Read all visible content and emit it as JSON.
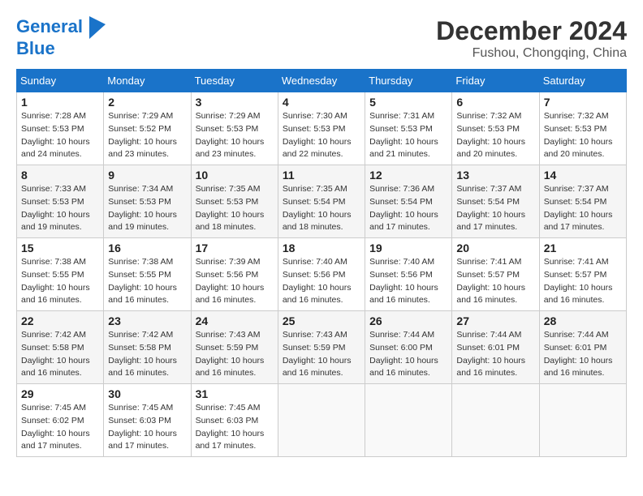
{
  "header": {
    "logo_line1": "General",
    "logo_line2": "Blue",
    "month_title": "December 2024",
    "location": "Fushou, Chongqing, China"
  },
  "days_of_week": [
    "Sunday",
    "Monday",
    "Tuesday",
    "Wednesday",
    "Thursday",
    "Friday",
    "Saturday"
  ],
  "weeks": [
    [
      {
        "day": "1",
        "sunrise": "7:28 AM",
        "sunset": "5:53 PM",
        "daylight": "10 hours and 24 minutes."
      },
      {
        "day": "2",
        "sunrise": "7:29 AM",
        "sunset": "5:52 PM",
        "daylight": "10 hours and 23 minutes."
      },
      {
        "day": "3",
        "sunrise": "7:29 AM",
        "sunset": "5:53 PM",
        "daylight": "10 hours and 23 minutes."
      },
      {
        "day": "4",
        "sunrise": "7:30 AM",
        "sunset": "5:53 PM",
        "daylight": "10 hours and 22 minutes."
      },
      {
        "day": "5",
        "sunrise": "7:31 AM",
        "sunset": "5:53 PM",
        "daylight": "10 hours and 21 minutes."
      },
      {
        "day": "6",
        "sunrise": "7:32 AM",
        "sunset": "5:53 PM",
        "daylight": "10 hours and 20 minutes."
      },
      {
        "day": "7",
        "sunrise": "7:32 AM",
        "sunset": "5:53 PM",
        "daylight": "10 hours and 20 minutes."
      }
    ],
    [
      {
        "day": "8",
        "sunrise": "7:33 AM",
        "sunset": "5:53 PM",
        "daylight": "10 hours and 19 minutes."
      },
      {
        "day": "9",
        "sunrise": "7:34 AM",
        "sunset": "5:53 PM",
        "daylight": "10 hours and 19 minutes."
      },
      {
        "day": "10",
        "sunrise": "7:35 AM",
        "sunset": "5:53 PM",
        "daylight": "10 hours and 18 minutes."
      },
      {
        "day": "11",
        "sunrise": "7:35 AM",
        "sunset": "5:54 PM",
        "daylight": "10 hours and 18 minutes."
      },
      {
        "day": "12",
        "sunrise": "7:36 AM",
        "sunset": "5:54 PM",
        "daylight": "10 hours and 17 minutes."
      },
      {
        "day": "13",
        "sunrise": "7:37 AM",
        "sunset": "5:54 PM",
        "daylight": "10 hours and 17 minutes."
      },
      {
        "day": "14",
        "sunrise": "7:37 AM",
        "sunset": "5:54 PM",
        "daylight": "10 hours and 17 minutes."
      }
    ],
    [
      {
        "day": "15",
        "sunrise": "7:38 AM",
        "sunset": "5:55 PM",
        "daylight": "10 hours and 16 minutes."
      },
      {
        "day": "16",
        "sunrise": "7:38 AM",
        "sunset": "5:55 PM",
        "daylight": "10 hours and 16 minutes."
      },
      {
        "day": "17",
        "sunrise": "7:39 AM",
        "sunset": "5:56 PM",
        "daylight": "10 hours and 16 minutes."
      },
      {
        "day": "18",
        "sunrise": "7:40 AM",
        "sunset": "5:56 PM",
        "daylight": "10 hours and 16 minutes."
      },
      {
        "day": "19",
        "sunrise": "7:40 AM",
        "sunset": "5:56 PM",
        "daylight": "10 hours and 16 minutes."
      },
      {
        "day": "20",
        "sunrise": "7:41 AM",
        "sunset": "5:57 PM",
        "daylight": "10 hours and 16 minutes."
      },
      {
        "day": "21",
        "sunrise": "7:41 AM",
        "sunset": "5:57 PM",
        "daylight": "10 hours and 16 minutes."
      }
    ],
    [
      {
        "day": "22",
        "sunrise": "7:42 AM",
        "sunset": "5:58 PM",
        "daylight": "10 hours and 16 minutes."
      },
      {
        "day": "23",
        "sunrise": "7:42 AM",
        "sunset": "5:58 PM",
        "daylight": "10 hours and 16 minutes."
      },
      {
        "day": "24",
        "sunrise": "7:43 AM",
        "sunset": "5:59 PM",
        "daylight": "10 hours and 16 minutes."
      },
      {
        "day": "25",
        "sunrise": "7:43 AM",
        "sunset": "5:59 PM",
        "daylight": "10 hours and 16 minutes."
      },
      {
        "day": "26",
        "sunrise": "7:44 AM",
        "sunset": "6:00 PM",
        "daylight": "10 hours and 16 minutes."
      },
      {
        "day": "27",
        "sunrise": "7:44 AM",
        "sunset": "6:01 PM",
        "daylight": "10 hours and 16 minutes."
      },
      {
        "day": "28",
        "sunrise": "7:44 AM",
        "sunset": "6:01 PM",
        "daylight": "10 hours and 16 minutes."
      }
    ],
    [
      {
        "day": "29",
        "sunrise": "7:45 AM",
        "sunset": "6:02 PM",
        "daylight": "10 hours and 17 minutes."
      },
      {
        "day": "30",
        "sunrise": "7:45 AM",
        "sunset": "6:03 PM",
        "daylight": "10 hours and 17 minutes."
      },
      {
        "day": "31",
        "sunrise": "7:45 AM",
        "sunset": "6:03 PM",
        "daylight": "10 hours and 17 minutes."
      },
      null,
      null,
      null,
      null
    ]
  ],
  "labels": {
    "sunrise_prefix": "Sunrise: ",
    "sunset_prefix": "Sunset: ",
    "daylight_prefix": "Daylight: "
  }
}
